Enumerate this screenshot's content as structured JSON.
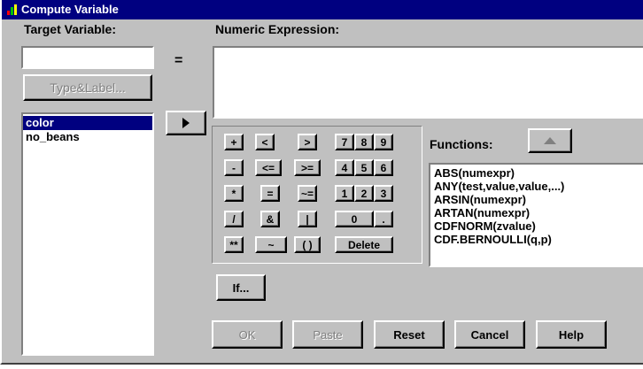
{
  "window": {
    "title": "Compute Variable"
  },
  "target": {
    "label": "Target Variable:",
    "value": "",
    "type_label_button": "Type&Label..."
  },
  "equals_sign": "=",
  "expression": {
    "label": "Numeric Expression:",
    "value": ""
  },
  "variables": {
    "items": [
      "color",
      "no_beans"
    ],
    "selected": "color"
  },
  "calculator": {
    "row1": [
      "+",
      "<",
      ">",
      "7",
      "8",
      "9"
    ],
    "row2": [
      "-",
      "<=",
      ">=",
      "4",
      "5",
      "6"
    ],
    "row3": [
      "*",
      "=",
      "~=",
      "1",
      "2",
      "3"
    ],
    "row4": [
      "/",
      "&",
      "|",
      "0",
      "."
    ],
    "row5": [
      "**",
      "~",
      "( )"
    ],
    "delete": "Delete"
  },
  "functions": {
    "label": "Functions:",
    "items": [
      "ABS(numexpr)",
      "ANY(test,value,value,...)",
      "ARSIN(numexpr)",
      "ARTAN(numexpr)",
      "CDFNORM(zvalue)",
      "CDF.BERNOULLI(q,p)"
    ]
  },
  "if_button": "If...",
  "buttons": {
    "ok": "OK",
    "paste": "Paste",
    "reset": "Reset",
    "cancel": "Cancel",
    "help": "Help"
  }
}
